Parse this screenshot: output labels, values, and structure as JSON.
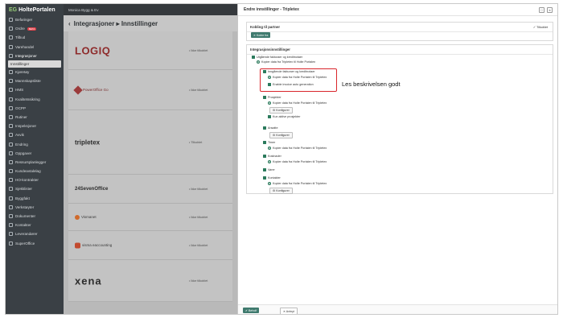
{
  "app": {
    "logo_prefix": "EG",
    "logo_name": "HoltePortalen",
    "user": "Monica Bygg & Ev"
  },
  "sidebar": {
    "items": [
      {
        "label": "Befaringer"
      },
      {
        "label": "Ordre",
        "badge": "BETA"
      },
      {
        "label": "Tilbud"
      },
      {
        "label": "Varehandel"
      },
      {
        "label": "Integrasjoner"
      },
      {
        "label": "Innstillinger"
      },
      {
        "label": "Kjøretøy"
      },
      {
        "label": "Mannskapsliste"
      },
      {
        "label": "HMS"
      },
      {
        "label": "Kvalitetssikring"
      },
      {
        "label": "OCPP"
      },
      {
        "label": "Rutiner"
      },
      {
        "label": "Inspeksjoner"
      },
      {
        "label": "Avvik"
      },
      {
        "label": "Endring"
      },
      {
        "label": "Oppgaver"
      },
      {
        "label": "Ressursplanlegger"
      },
      {
        "label": "Kundeavtalelag"
      },
      {
        "label": "HO-kontrakter"
      },
      {
        "label": "Sjekklister"
      },
      {
        "label": "Byggfakt"
      },
      {
        "label": "Verkstøyter"
      },
      {
        "label": "Dokumenter"
      },
      {
        "label": "Kontakter"
      },
      {
        "label": "Leverandører"
      },
      {
        "label": "SuperOffice"
      }
    ]
  },
  "main": {
    "title": "Integrasjoner ▸ Innstillinger",
    "integrations": [
      {
        "name": "LOGIQ",
        "status": "• Ikke tilkoblet"
      },
      {
        "name": "PowerOffice Go",
        "status": "• Ikke tilkoblet"
      },
      {
        "name": "tripletex",
        "status": "• Tilkoblet"
      },
      {
        "name": "24SevenOffice",
        "status": "• Ikke tilkoblet"
      },
      {
        "name": "Vismanet",
        "status": "• Ikke tilkoblet"
      },
      {
        "name": "visma eaccounting",
        "status": "• Ikke tilkoblet"
      },
      {
        "name": "xena",
        "status": "• Ikke tilkoblet"
      }
    ]
  },
  "modal": {
    "title": "Endre innstillinger - Tripletex",
    "ctrl_min": "□",
    "ctrl_close": "×",
    "connection": {
      "title": "Kobling til partner",
      "status": "✓ Tilkoblet",
      "button": "✕ Koble fra"
    },
    "settings": {
      "title": "Integrasjonsinnstillinger",
      "outgoing_heading": "Utgående fakturaer og kreditnotaer",
      "outgoing_radio": "Kopier data fra Tripletex til Holte Portalen",
      "incoming_heading": "Inngående fakturaer og kreditnotaer",
      "incoming_radio": "Kopier data fra Holte Portalen til Tripletex",
      "enable_invoice": "Enable invoice auto generation",
      "projects_heading": "Prosjekter",
      "projects_radio": "Kopier data fra Holte Portalen til Tripletex",
      "projects_only_active": "Kun aktive prosjekter",
      "products_heading": "Ansatte",
      "hours_heading": "Timer",
      "hours_radio": "Kopier data fra Holte Portalen til Tripletex",
      "costs_heading": "Kostnader",
      "costs_radio": "Kopier data fra Holte Portalen til Tripletex",
      "goods_heading": "Varer",
      "contacts_heading": "Kontakter",
      "contacts_radio": "Kopier data fra Holte Portalen til Tripletex",
      "configure": "⚙ Konfigurer"
    },
    "annotation": "Les beskrivelsen godt",
    "footer": {
      "save": "✔ Beholf",
      "cancel": "✕ Avbryt"
    }
  },
  "colors": {
    "sidebar_bg": "#3a4045",
    "accent_green": "#3f7a6e",
    "highlight_red": "#d9262c"
  }
}
